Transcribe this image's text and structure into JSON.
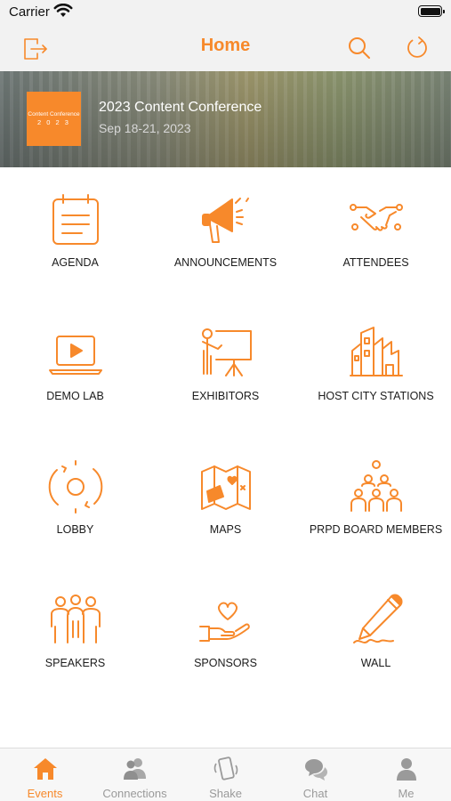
{
  "status_bar": {
    "carrier": "Carrier"
  },
  "nav": {
    "title": "Home",
    "left_icon": "logout-icon",
    "right_icons": [
      "search-icon",
      "refresh-icon"
    ]
  },
  "banner": {
    "logo_line1": "Content Conference",
    "logo_line2": "2 0 2 3",
    "title": "2023 Content Conference",
    "date": "Sep 18-21, 2023"
  },
  "colors": {
    "accent": "#f7892b",
    "tab_inactive": "#9a9a9a"
  },
  "grid": {
    "items": [
      {
        "label": "AGENDA",
        "icon": "agenda-icon"
      },
      {
        "label": "ANNOUNCEMENTS",
        "icon": "megaphone-icon"
      },
      {
        "label": "ATTENDEES",
        "icon": "handshake-icon"
      },
      {
        "label": "DEMO LAB",
        "icon": "laptop-play-icon"
      },
      {
        "label": "EXHIBITORS",
        "icon": "presentation-icon"
      },
      {
        "label": "HOST CITY STATIONS",
        "icon": "city-icon"
      },
      {
        "label": "LOBBY",
        "icon": "lobby-icon"
      },
      {
        "label": "MAPS",
        "icon": "map-icon"
      },
      {
        "label": "PRPD BOARD MEMBERS",
        "icon": "group-icon"
      },
      {
        "label": "SPEAKERS",
        "icon": "speakers-icon"
      },
      {
        "label": "SPONSORS",
        "icon": "heart-hand-icon"
      },
      {
        "label": "WALL",
        "icon": "pen-icon"
      }
    ]
  },
  "tabs": [
    {
      "label": "Events",
      "icon": "home-icon",
      "active": true
    },
    {
      "label": "Connections",
      "icon": "people-icon",
      "active": false
    },
    {
      "label": "Shake",
      "icon": "phone-shake-icon",
      "active": false
    },
    {
      "label": "Chat",
      "icon": "chat-icon",
      "active": false
    },
    {
      "label": "Me",
      "icon": "person-icon",
      "active": false
    }
  ]
}
